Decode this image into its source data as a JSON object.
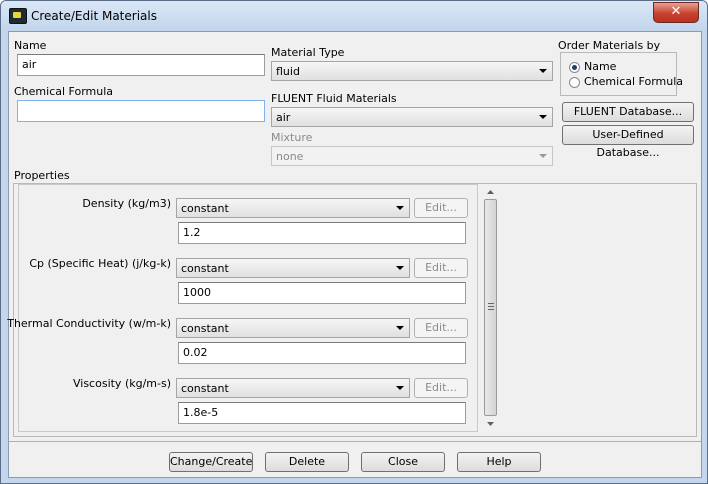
{
  "window": {
    "title": "Create/Edit Materials",
    "close_glyph": "✕"
  },
  "name": {
    "label": "Name",
    "value": "air"
  },
  "chemical_formula": {
    "label": "Chemical Formula",
    "value": ""
  },
  "material_type": {
    "label": "Material Type",
    "value": "fluid"
  },
  "fluent_materials": {
    "label": "FLUENT Fluid Materials",
    "value": "air"
  },
  "mixture": {
    "label": "Mixture",
    "value": "none"
  },
  "order": {
    "label": "Order Materials by",
    "options": [
      {
        "label": "Name",
        "selected": true
      },
      {
        "label": "Chemical Formula",
        "selected": false
      }
    ]
  },
  "buttons": {
    "fluent_db": "FLUENT Database...",
    "user_db": "User-Defined Database..."
  },
  "properties": {
    "label": "Properties",
    "items": [
      {
        "label": "Density (kg/m3)",
        "method": "constant",
        "edit": "Edit...",
        "value": "1.2"
      },
      {
        "label": "Cp (Specific Heat) (j/kg-k)",
        "method": "constant",
        "edit": "Edit...",
        "value": "1000"
      },
      {
        "label": "Thermal Conductivity (w/m-k)",
        "method": "constant",
        "edit": "Edit...",
        "value": "0.02"
      },
      {
        "label": "Viscosity (kg/m-s)",
        "method": "constant",
        "edit": "Edit...",
        "value": "1.8e-5"
      }
    ]
  },
  "footer": {
    "change_create": "Change/Create",
    "delete": "Delete",
    "close": "Close",
    "help": "Help"
  }
}
